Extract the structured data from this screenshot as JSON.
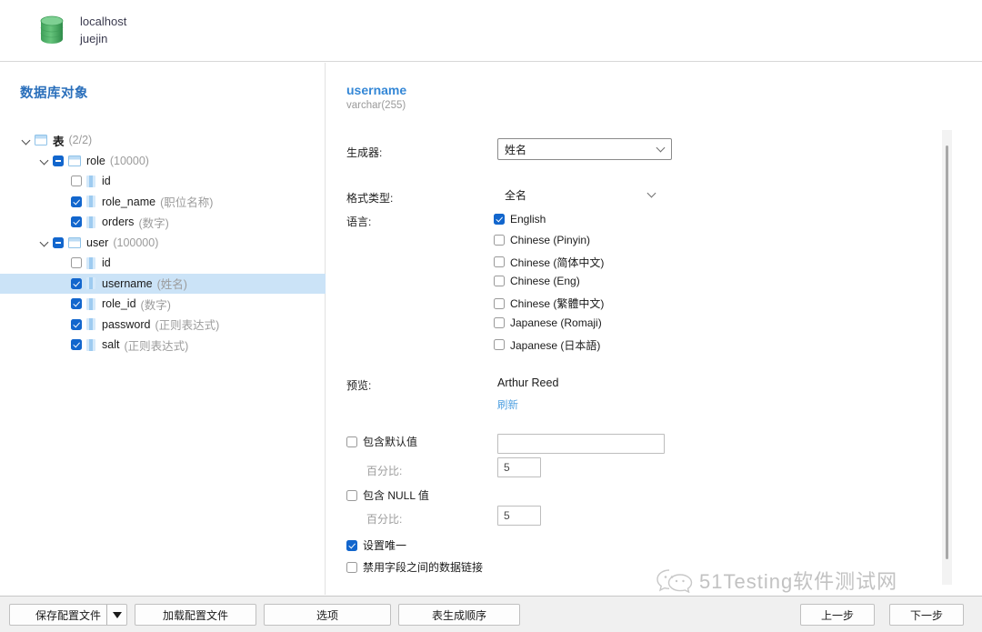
{
  "header": {
    "icon": "database-cylinder-icon",
    "connection_host": "localhost",
    "connection_db": "juejin"
  },
  "left_panel": {
    "title": "数据库对象",
    "tree": [
      {
        "label": "表",
        "count": "(2/2)",
        "depth": 0,
        "state": "none",
        "expanded": true,
        "icon": "table-folder-icon",
        "bold": true,
        "selected": false
      },
      {
        "label": "role",
        "count": "(10000)",
        "depth": 1,
        "state": "indeterminate",
        "expanded": true,
        "icon": "table-folder-icon",
        "bold": false,
        "selected": false
      },
      {
        "label": "id",
        "count": "",
        "depth": 2,
        "state": "unchecked",
        "expanded": null,
        "icon": "column-icon",
        "bold": false,
        "selected": false
      },
      {
        "label": "role_name",
        "count": "(职位名称)",
        "depth": 2,
        "state": "checked",
        "expanded": null,
        "icon": "column-icon",
        "bold": false,
        "selected": false
      },
      {
        "label": "orders",
        "count": "(数字)",
        "depth": 2,
        "state": "checked",
        "expanded": null,
        "icon": "column-icon",
        "bold": false,
        "selected": false
      },
      {
        "label": "user",
        "count": "(100000)",
        "depth": 1,
        "state": "indeterminate",
        "expanded": true,
        "icon": "table-folder-icon",
        "bold": false,
        "selected": false
      },
      {
        "label": "id",
        "count": "",
        "depth": 2,
        "state": "unchecked",
        "expanded": null,
        "icon": "column-icon",
        "bold": false,
        "selected": false
      },
      {
        "label": "username",
        "count": "(姓名)",
        "depth": 2,
        "state": "checked",
        "expanded": null,
        "icon": "column-icon",
        "bold": false,
        "selected": true
      },
      {
        "label": "role_id",
        "count": "(数字)",
        "depth": 2,
        "state": "checked",
        "expanded": null,
        "icon": "column-icon",
        "bold": false,
        "selected": false
      },
      {
        "label": "password",
        "count": "(正则表达式)",
        "depth": 2,
        "state": "checked",
        "expanded": null,
        "icon": "column-icon",
        "bold": false,
        "selected": false
      },
      {
        "label": "salt",
        "count": "(正则表达式)",
        "depth": 2,
        "state": "checked",
        "expanded": null,
        "icon": "column-icon",
        "bold": false,
        "selected": false
      }
    ]
  },
  "right_panel": {
    "field_name": "username",
    "field_type": "varchar(255)",
    "generator_label": "生成器:",
    "generator_value": "姓名",
    "format_label": "格式类型:",
    "format_value": "全名",
    "language_label": "语言:",
    "languages": [
      {
        "label": "English",
        "checked": true
      },
      {
        "label": "Chinese (Pinyin)",
        "checked": false
      },
      {
        "label": "Chinese (简体中文)",
        "checked": false
      },
      {
        "label": "Chinese (Eng)",
        "checked": false
      },
      {
        "label": "Chinese (繁體中文)",
        "checked": false
      },
      {
        "label": "Japanese (Romaji)",
        "checked": false
      },
      {
        "label": "Japanese (日本語)",
        "checked": false
      }
    ],
    "preview_label": "预览:",
    "preview_value": "Arthur Reed",
    "refresh_link": "刷新",
    "include_default_label": "包含默认值",
    "include_default_checked": false,
    "default_value": "",
    "default_percent_label": "百分比:",
    "default_percent_value": "5",
    "include_null_label": "包含 NULL 值",
    "include_null_checked": false,
    "null_percent_label": "百分比:",
    "null_percent_value": "5",
    "set_unique_label": "设置唯一",
    "set_unique_checked": true,
    "disable_link_label": "禁用字段之间的数据链接",
    "disable_link_checked": false
  },
  "bottom_bar": {
    "save_profile": "保存配置文件",
    "load_profile": "加载配置文件",
    "options": "选项",
    "table_order": "表生成顺序",
    "prev": "上一步",
    "next": "下一步"
  },
  "watermark": {
    "text": "51Testing软件测试网",
    "logo": "wechat-icon"
  },
  "colors": {
    "accent": "#1266cd",
    "title": "#2a6fbb",
    "field_title": "#3487d6",
    "selection": "#cbe3f7",
    "link": "#4d9fe0"
  }
}
